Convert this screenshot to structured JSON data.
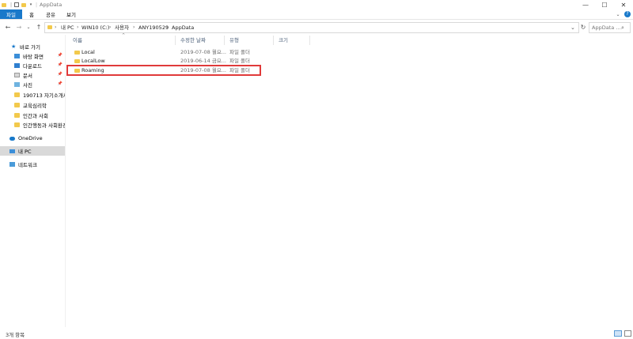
{
  "titlebar": {
    "title": "AppData",
    "controls": {
      "minimize": "—",
      "maximize": "☐",
      "close": "✕"
    }
  },
  "ribbon": {
    "tabs": [
      "파일",
      "홈",
      "공유",
      "보기"
    ],
    "help_icon": "?"
  },
  "address": {
    "crumbs": [
      "내 PC",
      "WIN10 (C:)",
      "사용자",
      "ANY190529",
      "AppData"
    ],
    "search_placeholder": "AppData ..."
  },
  "sidebar": {
    "quick_access": "바로 가기",
    "items": [
      "바탕 화면",
      "다운로드",
      "문서",
      "사진",
      "190713 자기소개서",
      "교육심리학",
      "인간과 사회",
      "인간행동과 사회환경"
    ],
    "onedrive": "OneDrive",
    "this_pc": "내 PC",
    "network": "네트워크"
  },
  "columns": {
    "name": "이름",
    "date": "수정한 날짜",
    "type": "유형",
    "size": "크기"
  },
  "files": [
    {
      "name": "Local",
      "date": "2019-07-08 월요...",
      "type": "파일 폴더"
    },
    {
      "name": "LocalLow",
      "date": "2019-06-14 금요...",
      "type": "파일 폴더"
    },
    {
      "name": "Roaming",
      "date": "2019-07-08 월요...",
      "type": "파일 폴더"
    }
  ],
  "status": {
    "count": "3개 항목"
  },
  "colors": {
    "accent": "#1979ca",
    "highlight": "#e03a3a",
    "folder": "#f2c94c",
    "selected": "#d9d9d9"
  }
}
